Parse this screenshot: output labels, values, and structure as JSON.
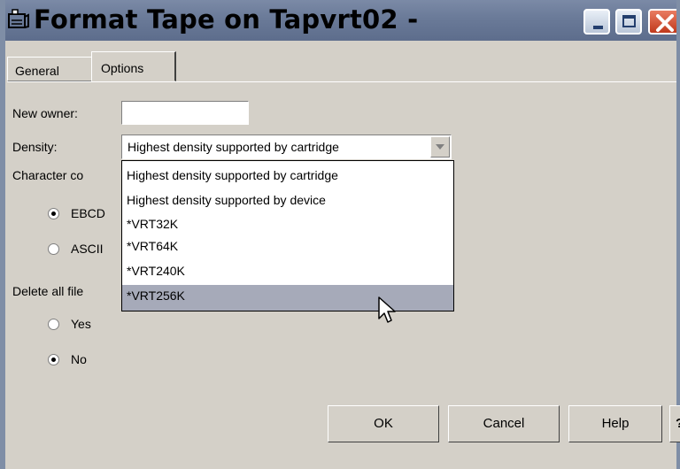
{
  "window": {
    "title": "Format Tape on Tapvrt02   -",
    "title_bar_color": "#6a7a98"
  },
  "tabs": [
    {
      "label": "General",
      "active": false
    },
    {
      "label": "Options",
      "active": true
    }
  ],
  "form": {
    "new_owner_label": "New owner:",
    "new_owner_value": "",
    "density_label": "Density:",
    "density_value": "Highest density supported by cartridge",
    "character_code_label": "Character co",
    "character_code_options": [
      {
        "label": "EBCD",
        "checked": true
      },
      {
        "label": "ASCII",
        "checked": false
      }
    ],
    "delete_all_files_label": "Delete all file",
    "delete_all_files_options": [
      {
        "label": "Yes",
        "checked": false
      },
      {
        "label": "No",
        "checked": true
      }
    ]
  },
  "density_dropdown": {
    "open": true,
    "options": [
      "Highest density supported by cartridge",
      "Highest density supported by device",
      "*VRT32K",
      "*VRT64K",
      "*VRT240K",
      "*VRT256K"
    ],
    "highlighted": "*VRT256K",
    "highlight_color": "#a6aab9"
  },
  "buttons": {
    "ok": "OK",
    "cancel": "Cancel",
    "help": "Help",
    "context_help": "?"
  }
}
